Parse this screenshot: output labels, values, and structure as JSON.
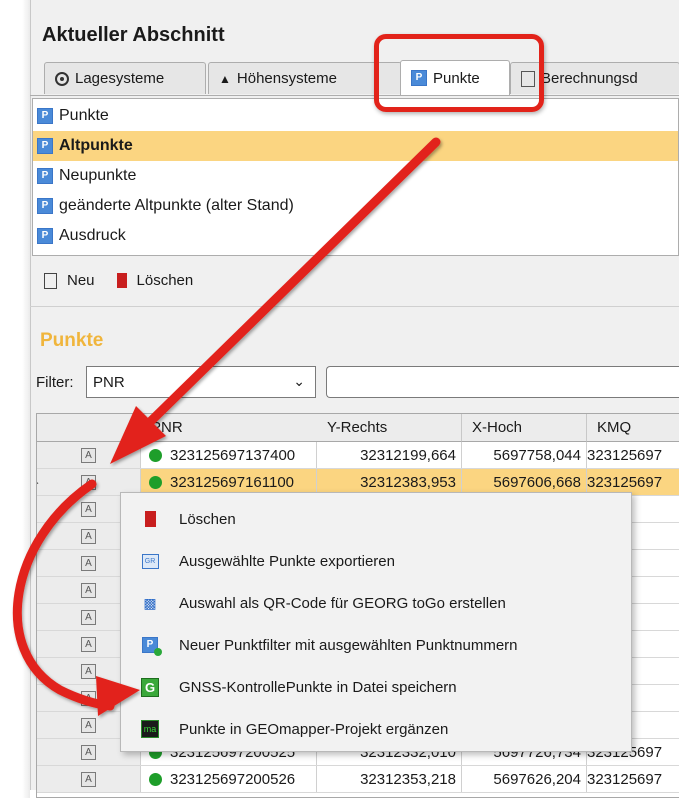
{
  "section": {
    "title": "Aktueller Abschnitt"
  },
  "tabs": [
    {
      "label": "Lagesysteme",
      "icon": "target-icon"
    },
    {
      "label": "Höhensysteme",
      "icon": "mountain-icon"
    },
    {
      "label": "Punkte",
      "icon": "p-icon"
    },
    {
      "label": "Berechnungsd",
      "icon": "calc-icon"
    }
  ],
  "filter_list": [
    {
      "label": "Punkte"
    },
    {
      "label": "Altpunkte"
    },
    {
      "label": "Neupunkte"
    },
    {
      "label": "geänderte Altpunkte (alter Stand)"
    },
    {
      "label": "Ausdruck"
    }
  ],
  "toolbar": {
    "new_label": "Neu",
    "delete_label": "Löschen"
  },
  "points": {
    "title": "Punkte",
    "filter_label": "Filter:",
    "filter_value": "PNR"
  },
  "grid": {
    "columns": [
      "PNR",
      "Y-Rechts",
      "X-Hoch",
      "KMQ"
    ],
    "rows": [
      {
        "pnr": "323125697137400",
        "y": "32312199,664",
        "x": "5697758,044",
        "kmq": "323125697"
      },
      {
        "pnr": "323125697161100",
        "y": "32312383,953",
        "x": "5697606,668",
        "kmq": "323125697"
      },
      {
        "pnr": "",
        "y": "",
        "x": "",
        "kmq": "25697"
      },
      {
        "pnr": "",
        "y": "",
        "x": "",
        "kmq": "25697"
      },
      {
        "pnr": "",
        "y": "",
        "x": "",
        "kmq": "25697"
      },
      {
        "pnr": "",
        "y": "",
        "x": "",
        "kmq": "25697"
      },
      {
        "pnr": "",
        "y": "",
        "x": "",
        "kmq": "25697"
      },
      {
        "pnr": "",
        "y": "",
        "x": "",
        "kmq": "25697"
      },
      {
        "pnr": "",
        "y": "",
        "x": "",
        "kmq": "25697"
      },
      {
        "pnr": "",
        "y": "",
        "x": "",
        "kmq": "25697"
      },
      {
        "pnr": "",
        "y": "",
        "x": "",
        "kmq": "25697"
      },
      {
        "pnr": "323125697200525",
        "y": "32312332,010",
        "x": "5697726,734",
        "kmq": "323125697"
      },
      {
        "pnr": "323125697200526",
        "y": "32312353,218",
        "x": "5697626,204",
        "kmq": "323125697"
      }
    ]
  },
  "context_menu": [
    {
      "label": "Löschen",
      "icon": "trash-icon"
    },
    {
      "label": "Ausgewählte Punkte exportieren",
      "icon": "export-icon"
    },
    {
      "label": "Auswahl als QR-Code für GEORG toGo erstellen",
      "icon": "qr-code-icon"
    },
    {
      "label": "Neuer Punktfilter mit ausgewählten Punktnummern",
      "icon": "new-filter-icon"
    },
    {
      "label": "GNSS-KontrollePunkte in Datei speichern",
      "icon": "gnss-icon"
    },
    {
      "label": "Punkte in GEOmapper-Projekt ergänzen",
      "icon": "geomapper-icon"
    }
  ],
  "colors": {
    "selection": "#fbd581",
    "accent_title": "#f0b53c",
    "annotation_red": "#e2231a",
    "point_green": "#1e9e2a"
  }
}
